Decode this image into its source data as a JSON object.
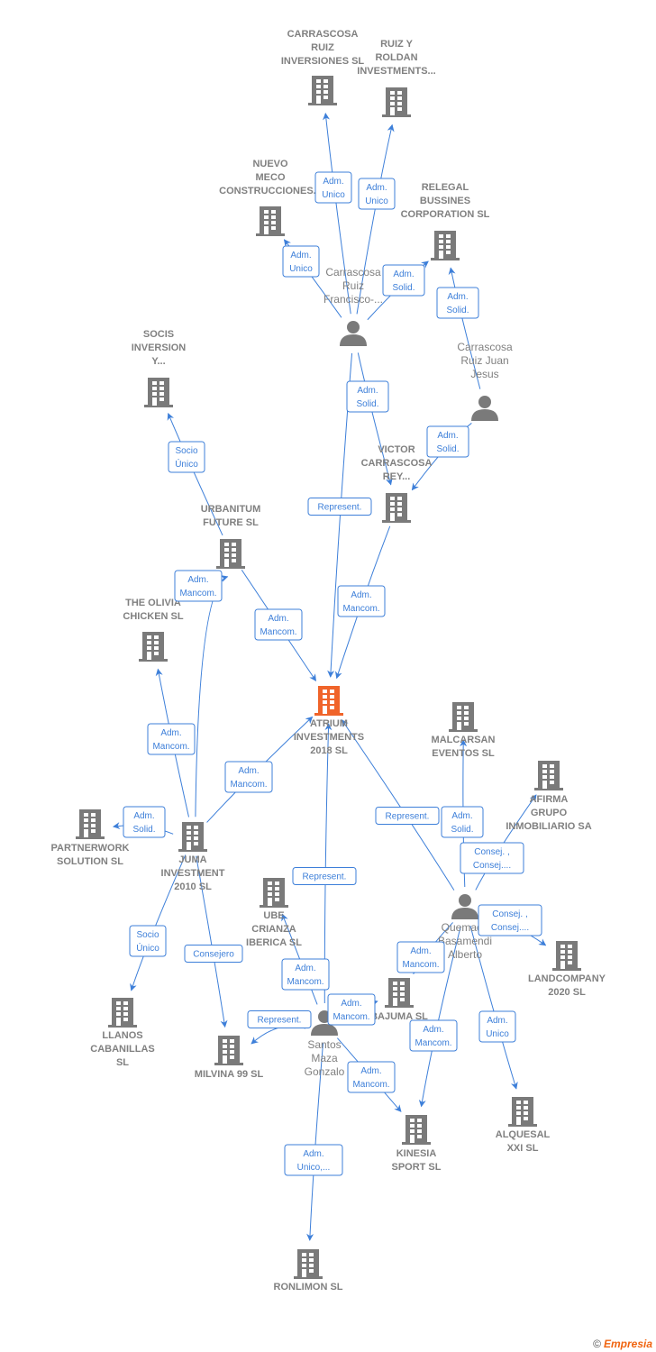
{
  "colors": {
    "edge": "#3d7fd9",
    "node": "#7a7a7a",
    "focus": "#f0642a",
    "text": "#808080"
  },
  "nodes": [
    {
      "id": "carrascosa_inv",
      "type": "company",
      "label": [
        "CARRASCOSA",
        "RUIZ",
        "INVERSIONES SL"
      ]
    },
    {
      "id": "ruiz_roldan",
      "type": "company",
      "label": [
        "RUIZ Y",
        "ROLDAN",
        "INVESTMENTS..."
      ]
    },
    {
      "id": "nuevo_meco",
      "type": "company",
      "label": [
        "NUEVO",
        "MECO",
        "CONSTRUCCIONES..."
      ]
    },
    {
      "id": "relegal",
      "type": "company",
      "label": [
        "RELEGAL",
        "BUSSINES",
        "CORPORATION SL"
      ]
    },
    {
      "id": "francisco",
      "type": "person",
      "label": [
        "Carrascosa",
        "Ruiz",
        "Francisco-..."
      ]
    },
    {
      "id": "juan",
      "type": "person",
      "label": [
        "Carrascosa",
        "Ruiz Juan",
        "Jesus"
      ]
    },
    {
      "id": "socis",
      "type": "company",
      "label": [
        "SOCIS",
        "INVERSION",
        "Y..."
      ]
    },
    {
      "id": "victor",
      "type": "company",
      "label": [
        "VICTOR",
        "CARRASCOSA",
        "REY..."
      ]
    },
    {
      "id": "urbanitum",
      "type": "company",
      "label": [
        "URBANITUM",
        "FUTURE  SL"
      ]
    },
    {
      "id": "olivia",
      "type": "company",
      "label": [
        "THE OLIVIA",
        "CHICKEN  SL"
      ]
    },
    {
      "id": "atrium",
      "type": "focus",
      "label": [
        "ATRIUM",
        "INVESTMENTS",
        "2018  SL"
      ]
    },
    {
      "id": "malcarsan",
      "type": "company",
      "label": [
        "MALCARSAN",
        "EVENTOS  SL"
      ]
    },
    {
      "id": "afirma",
      "type": "company",
      "label": [
        "AFIRMA",
        "GRUPO",
        "INMOBILIARIO SA"
      ]
    },
    {
      "id": "partnerwork",
      "type": "company",
      "label": [
        "PARTNERWORK",
        "SOLUTION SL"
      ]
    },
    {
      "id": "juma",
      "type": "company",
      "label": [
        "JUMA",
        "INVESTMENT",
        "2010  SL"
      ]
    },
    {
      "id": "ube",
      "type": "company",
      "label": [
        "UBE",
        "CRIANZA",
        "IBERICA  SL"
      ]
    },
    {
      "id": "quemada",
      "type": "person",
      "label": [
        "Quemada",
        "Basamendi",
        "Alberto"
      ]
    },
    {
      "id": "landcompany",
      "type": "company",
      "label": [
        "LANDCOMPANY",
        "2020  SL"
      ]
    },
    {
      "id": "bajuma",
      "type": "company",
      "label": [
        "BAJUMA  SL"
      ]
    },
    {
      "id": "llanos",
      "type": "company",
      "label": [
        "LLANOS",
        "CABANILLAS",
        "SL"
      ]
    },
    {
      "id": "santos",
      "type": "person",
      "label": [
        "Santos",
        "Maza",
        "Gonzalo"
      ]
    },
    {
      "id": "milvina",
      "type": "company",
      "label": [
        "MILVINA 99 SL"
      ]
    },
    {
      "id": "alquesal",
      "type": "company",
      "label": [
        "ALQUESAL",
        "XXI  SL"
      ]
    },
    {
      "id": "kinesia",
      "type": "company",
      "label": [
        "KINESIA",
        "SPORT  SL"
      ]
    },
    {
      "id": "ronlimon",
      "type": "company",
      "label": [
        "RONLIMON SL"
      ]
    }
  ],
  "edges": [
    {
      "from": "francisco",
      "to": "carrascosa_inv",
      "label": [
        "Adm.",
        "Unico"
      ]
    },
    {
      "from": "francisco",
      "to": "ruiz_roldan",
      "label": [
        "Adm.",
        "Unico"
      ]
    },
    {
      "from": "francisco",
      "to": "nuevo_meco",
      "label": [
        "Adm.",
        "Unico"
      ]
    },
    {
      "from": "francisco",
      "to": "relegal",
      "label": [
        "Adm.",
        "Solid."
      ]
    },
    {
      "from": "juan",
      "to": "relegal",
      "label": [
        "Adm.",
        "Solid."
      ]
    },
    {
      "from": "francisco",
      "to": "victor",
      "label": [
        "Adm.",
        "Solid."
      ]
    },
    {
      "from": "juan",
      "to": "victor",
      "label": [
        "Adm.",
        "Solid."
      ]
    },
    {
      "from": "francisco",
      "to": "atrium",
      "label": [
        "Represent."
      ]
    },
    {
      "from": "victor",
      "to": "atrium",
      "label": [
        "Adm.",
        "Mancom."
      ]
    },
    {
      "from": "urbanitum",
      "to": "socis",
      "label": [
        "Socio",
        "Único"
      ]
    },
    {
      "from": "urbanitum",
      "to": "atrium",
      "label": [
        "Adm.",
        "Mancom."
      ]
    },
    {
      "from": "juma",
      "to": "urbanitum",
      "label": [
        "Adm.",
        "Mancom."
      ]
    },
    {
      "from": "juma",
      "to": "olivia",
      "label": [
        "Adm.",
        "Mancom."
      ]
    },
    {
      "from": "juma",
      "to": "atrium",
      "label": [
        "Adm.",
        "Mancom."
      ]
    },
    {
      "from": "juma",
      "to": "partnerwork",
      "label": [
        "Adm.",
        "Solid."
      ]
    },
    {
      "from": "juma",
      "to": "llanos",
      "label": [
        "Socio",
        "Único"
      ]
    },
    {
      "from": "juma",
      "to": "milvina",
      "label": [
        "Consejero"
      ]
    },
    {
      "from": "santos",
      "to": "atrium",
      "label": [
        "Represent."
      ]
    },
    {
      "from": "santos",
      "to": "ube",
      "label": [
        "Adm.",
        "Mancom."
      ]
    },
    {
      "from": "santos",
      "to": "bajuma",
      "label": [
        "Adm.",
        "Mancom."
      ]
    },
    {
      "from": "santos",
      "to": "milvina",
      "label": [
        "Represent."
      ]
    },
    {
      "from": "santos",
      "to": "kinesia",
      "label": [
        "Adm.",
        "Mancom."
      ]
    },
    {
      "from": "santos",
      "to": "ronlimon",
      "label": [
        "Adm.",
        "Unico,..."
      ]
    },
    {
      "from": "quemada",
      "to": "atrium",
      "label": [
        "Represent."
      ]
    },
    {
      "from": "quemada",
      "to": "malcarsan",
      "label": [
        "Adm.",
        "Solid."
      ]
    },
    {
      "from": "quemada",
      "to": "afirma",
      "label": [
        "Consej. ,",
        "Consej...."
      ]
    },
    {
      "from": "quemada",
      "to": "landcompany",
      "label": [
        "Consej. ,",
        "Consej...."
      ]
    },
    {
      "from": "quemada",
      "to": "bajuma",
      "label": [
        "Adm.",
        "Mancom."
      ]
    },
    {
      "from": "quemada",
      "to": "kinesia",
      "label": [
        "Adm.",
        "Mancom."
      ]
    },
    {
      "from": "quemada",
      "to": "alquesal",
      "label": [
        "Adm.",
        "Unico"
      ]
    }
  ],
  "footer": {
    "copyright": "©",
    "brand": "Empresia"
  }
}
